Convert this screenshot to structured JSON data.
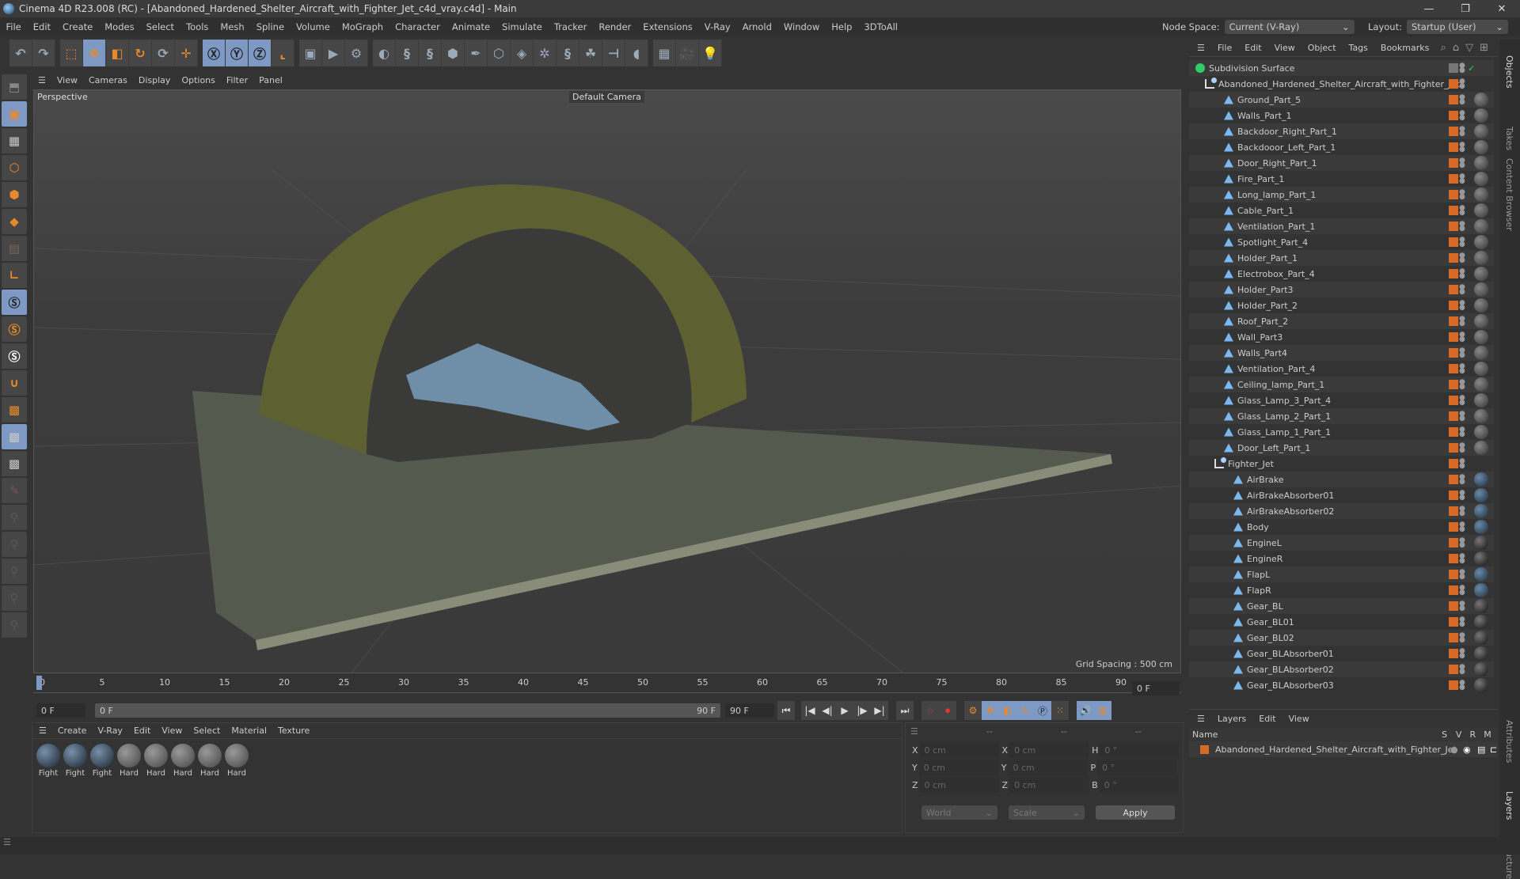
{
  "window": {
    "title": "Cinema 4D R23.008 (RC) - [Abandoned_Hardened_Shelter_Aircraft_with_Fighter_Jet_c4d_vray.c4d] - Main",
    "minimize": "—",
    "restore": "❐",
    "close": "✕"
  },
  "menu": [
    "File",
    "Edit",
    "Create",
    "Modes",
    "Select",
    "Tools",
    "Mesh",
    "Spline",
    "Volume",
    "MoGraph",
    "Character",
    "Animate",
    "Simulate",
    "Tracker",
    "Render",
    "Extensions",
    "V-Ray",
    "Arnold",
    "Window",
    "Help",
    "3DToAll"
  ],
  "node_space": {
    "label": "Node Space:",
    "value": "Current (V-Ray)"
  },
  "layout": {
    "label": "Layout:",
    "value": "Startup (User)"
  },
  "toolbar": [
    "undo-icon",
    "redo-icon",
    "select-icon",
    "move-icon",
    "scale-icon",
    "rotate-icon",
    "psr-icon",
    "move-axis-icon",
    "x-axis-icon",
    "y-axis-icon",
    "z-axis-icon",
    "coordinate-system-icon",
    "render-view-icon",
    "render-icon",
    "render-settings-icon",
    "vray-icon",
    "python-icon",
    "python2-icon",
    "cube-icon",
    "pen-icon",
    "subdivision-icon",
    "extrude-icon",
    "mograph-icon",
    "python3-icon",
    "cloner-icon",
    "deformer-icon",
    "field-icon",
    "floor-icon",
    "camera-icon",
    "light-icon"
  ],
  "viewport": {
    "menu": [
      "View",
      "Cameras",
      "Display",
      "Options",
      "Filter",
      "Panel"
    ],
    "label": "Perspective",
    "camera": "Default Camera",
    "grid_spacing": "Grid Spacing : 500 cm"
  },
  "timeline": {
    "ticks": [
      "0",
      "5",
      "10",
      "15",
      "20",
      "25",
      "30",
      "35",
      "40",
      "45",
      "50",
      "55",
      "60",
      "65",
      "70",
      "75",
      "80",
      "85",
      "90"
    ],
    "current": "0 F",
    "start": "0 F",
    "range_start": "0 F",
    "range_end": "90 F",
    "end": "90 F",
    "frame_right": "0 F"
  },
  "materials": {
    "menu": [
      "Create",
      "V-Ray",
      "Edit",
      "View",
      "Select",
      "Material",
      "Texture"
    ],
    "items": [
      "Fight",
      "Fight",
      "Fight",
      "Hard",
      "Hard",
      "Hard",
      "Hard",
      "Hard"
    ]
  },
  "coords": {
    "header": [
      "--",
      "--",
      "--"
    ],
    "rows": [
      {
        "a": "X",
        "av": "0 cm",
        "b": "X",
        "bv": "0 cm",
        "c": "H",
        "cv": "0 °"
      },
      {
        "a": "Y",
        "av": "0 cm",
        "b": "Y",
        "bv": "0 cm",
        "c": "P",
        "cv": "0 °"
      },
      {
        "a": "Z",
        "av": "0 cm",
        "b": "Z",
        "bv": "0 cm",
        "c": "B",
        "cv": "0 °"
      }
    ],
    "world": "World",
    "scale": "Scale",
    "apply": "Apply"
  },
  "objects": {
    "menu": [
      "File",
      "Edit",
      "View",
      "Object",
      "Tags",
      "Bookmarks"
    ],
    "root": "Subdivision Surface",
    "group": "Abandoned_Hardened_Shelter_Aircraft_with_Fighter_Jet",
    "parts": [
      "Ground_Part_5",
      "Walls_Part_1",
      "Backdoor_Right_Part_1",
      "Backdooor_Left_Part_1",
      "Door_Right_Part_1",
      "Fire_Part_1",
      "Long_lamp_Part_1",
      "Cable_Part_1",
      "Ventilation_Part_1",
      "Spotlight_Part_4",
      "Holder_Part_1",
      "Electrobox_Part_4",
      "Holder_Part3",
      "Holder_Part_2",
      "Roof_Part_2",
      "Wall_Part3",
      "Walls_Part4",
      "Ventilation_Part_4",
      "Ceiling_lamp_Part_1",
      "Glass_Lamp_3_Part_4",
      "Glass_Lamp_2_Part_1",
      "Glass_Lamp_1_Part_1",
      "Door_Left_Part_1"
    ],
    "jet": "Fighter_Jet",
    "jet_parts": [
      "AirBrake",
      "AirBrakeAbsorber01",
      "AirBrakeAbsorber02",
      "Body",
      "EngineL",
      "EngineR",
      "FlapL",
      "FlapR",
      "Gear_BL",
      "Gear_BL01",
      "Gear_BL02",
      "Gear_BLAbsorber01",
      "Gear_BLAbsorber02",
      "Gear_BLAbsorber03"
    ]
  },
  "layers": {
    "menu": [
      "Layers",
      "Edit",
      "View"
    ],
    "cols": [
      "Name",
      "S",
      "V",
      "R",
      "M"
    ],
    "item": "Abandoned_Hardened_Shelter_Aircraft_with_Fighter_Jet"
  },
  "side_tabs": [
    "Objects",
    "Takes",
    "Content Browser",
    "Attributes",
    "Layers",
    "Structure"
  ],
  "colors": {
    "accent": "#7d99c4",
    "layer": "#d86a28"
  }
}
